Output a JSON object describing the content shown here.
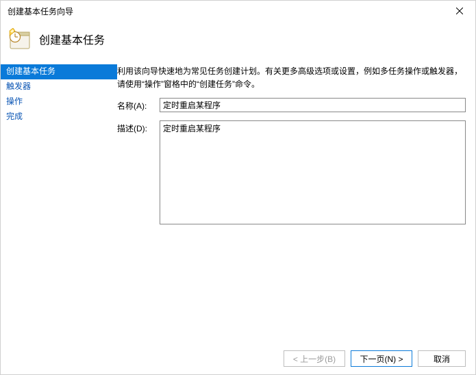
{
  "window": {
    "title": "创建基本任务向导"
  },
  "header": {
    "title": "创建基本任务"
  },
  "sidebar": {
    "items": [
      {
        "label": "创建基本任务",
        "active": true
      },
      {
        "label": "触发器",
        "active": false
      },
      {
        "label": "操作",
        "active": false
      },
      {
        "label": "完成",
        "active": false
      }
    ]
  },
  "content": {
    "instruction": "利用该向导快速地为常见任务创建计划。有关更多高级选项或设置，例如多任务操作或触发器，请使用“操作”窗格中的“创建任务”命令。",
    "name_label": "名称(A):",
    "name_value": "定时重启某程序",
    "desc_label": "描述(D):",
    "desc_value": "定时重启某程序"
  },
  "footer": {
    "back": "< 上一步(B)",
    "next": "下一页(N) >",
    "cancel": "取消"
  }
}
